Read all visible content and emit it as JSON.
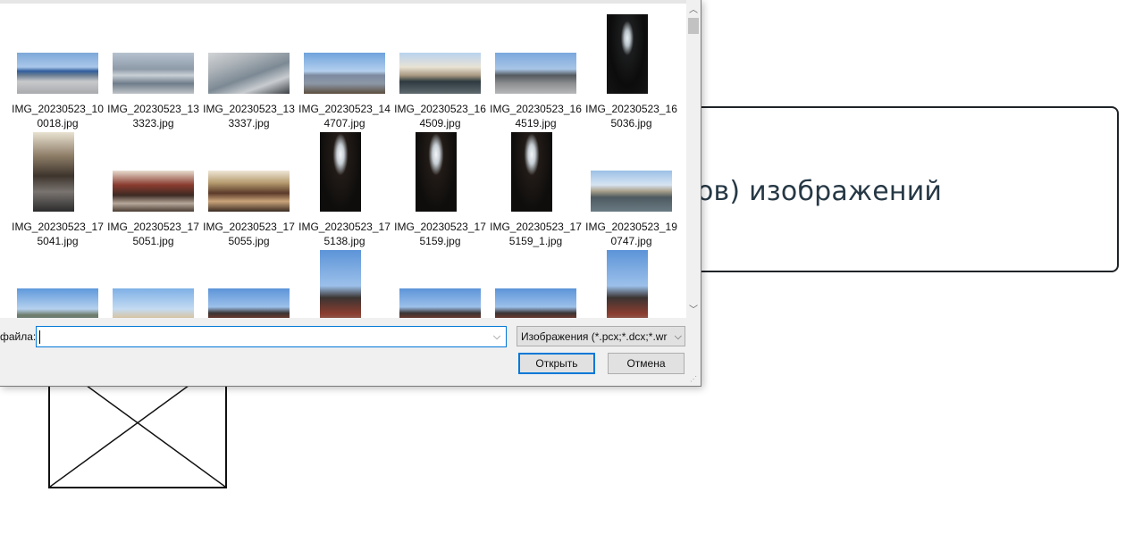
{
  "background": {
    "card_text": "ов) изображений"
  },
  "dialog": {
    "file_name_label": "файла:",
    "file_name_value": "",
    "filter_value": "Изображения (*.pcx;*.dcx;*.wr",
    "open_button": "Открыть",
    "cancel_button": "Отмена"
  },
  "files": [
    {
      "line1": "IMG_20230523_10",
      "line2": "0018.jpg",
      "thumb": "airport"
    },
    {
      "line1": "IMG_20230523_13",
      "line2": "3323.jpg",
      "thumb": "sky1"
    },
    {
      "line1": "IMG_20230523_13",
      "line2": "3337.jpg",
      "thumb": "plane"
    },
    {
      "line1": "IMG_20230523_14",
      "line2": "4707.jpg",
      "thumb": "river"
    },
    {
      "line1": "IMG_20230523_16",
      "line2": "4509.jpg",
      "thumb": "canal"
    },
    {
      "line1": "IMG_20230523_16",
      "line2": "4519.jpg",
      "thumb": "square"
    },
    {
      "line1": "IMG_20230523_16",
      "line2": "5036.jpg",
      "thumb": "doorway"
    },
    {
      "line1": "IMG_20230523_17",
      "line2": "5041.jpg",
      "thumb": "hall"
    },
    {
      "line1": "IMG_20230523_17",
      "line2": "5051.jpg",
      "thumb": "interior-red"
    },
    {
      "line1": "IMG_20230523_17",
      "line2": "5055.jpg",
      "thumb": "interior-gold"
    },
    {
      "line1": "IMG_20230523_17",
      "line2": "5138.jpg",
      "thumb": "window"
    },
    {
      "line1": "IMG_20230523_17",
      "line2": "5159.jpg",
      "thumb": "window"
    },
    {
      "line1": "IMG_20230523_17",
      "line2": "5159_1.jpg",
      "thumb": "window"
    },
    {
      "line1": "IMG_20230523_19",
      "line2": "0747.jpg",
      "thumb": "embank"
    },
    {
      "line1": "",
      "line2": "",
      "thumb": "riverwide"
    },
    {
      "line1": "",
      "line2": "",
      "thumb": "palace"
    },
    {
      "line1": "",
      "line2": "",
      "thumb": "monument"
    },
    {
      "line1": "",
      "line2": "",
      "thumb": "monument"
    },
    {
      "line1": "",
      "line2": "",
      "thumb": "monument"
    },
    {
      "line1": "",
      "line2": "",
      "thumb": "monument"
    },
    {
      "line1": "",
      "line2": "",
      "thumb": "monument"
    }
  ]
}
